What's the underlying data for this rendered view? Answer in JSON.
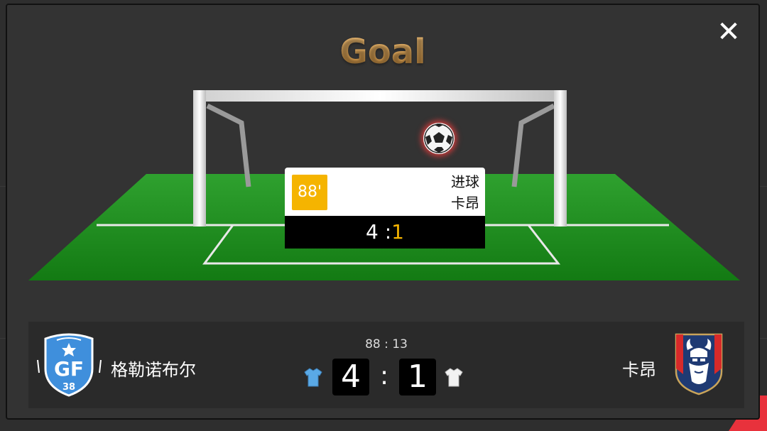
{
  "modal": {
    "title": "Goal",
    "close_icon": "close-icon"
  },
  "event": {
    "minute": "88'",
    "type": "进球",
    "team": "卡昂",
    "score_home": "4",
    "score_separator": " :",
    "score_away": "1"
  },
  "match": {
    "clock": "88 : 13",
    "home": {
      "name": "格勒诺布尔",
      "score": "4",
      "logo": "grenoble-gf38-crest",
      "logo_text": "GF",
      "logo_number": "38",
      "kit_color": "#5aa9e6"
    },
    "away": {
      "name": "卡昂",
      "score": "1",
      "logo": "caen-viking-crest",
      "kit_color": "#f2f2f2"
    },
    "separator": ":"
  },
  "colors": {
    "accent_gold": "#e0a85a",
    "minute_badge": "#f5b400",
    "pitch_green": "#1f8a1f",
    "background": "#333333"
  }
}
